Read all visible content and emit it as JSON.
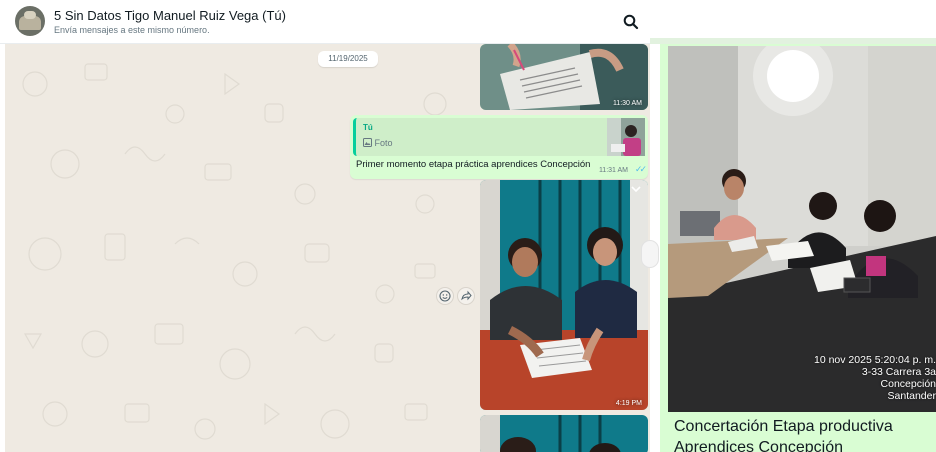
{
  "header": {
    "title": "5 Sin Datos Tigo Manuel Ruiz Vega (Tú)",
    "subtitle": "Envía mensajes a este mismo número."
  },
  "chat": {
    "date_separator": "11/19/2025",
    "messages": [
      {
        "kind": "image",
        "time": "11:30 AM"
      },
      {
        "kind": "reply",
        "quote_author": "Tú",
        "quote_type": "Foto",
        "text": "Primer momento etapa práctica aprendices Concepción",
        "time": "11:31 AM",
        "status": "read"
      },
      {
        "kind": "image",
        "time": "4:19 PM"
      },
      {
        "kind": "image",
        "time": ""
      }
    ]
  },
  "preview": {
    "stamp": {
      "line1": "10 nov 2025 5:20:04 p. m.",
      "line2": "3-33 Carrera 3a",
      "line3": "Concepción",
      "line4": "Santander"
    },
    "caption": "Concertación Etapa productiva Aprendices Concepción"
  },
  "icons": [
    "search-icon",
    "chevron-down-icon",
    "emoji-icon",
    "forward-icon",
    "double-check-icon",
    "photo-icon"
  ],
  "colors": {
    "chat_bg": "#efeae2",
    "outgoing_bubble": "#d9fdd3",
    "accent": "#06cf9c",
    "read_ticks": "#53bdeb"
  }
}
